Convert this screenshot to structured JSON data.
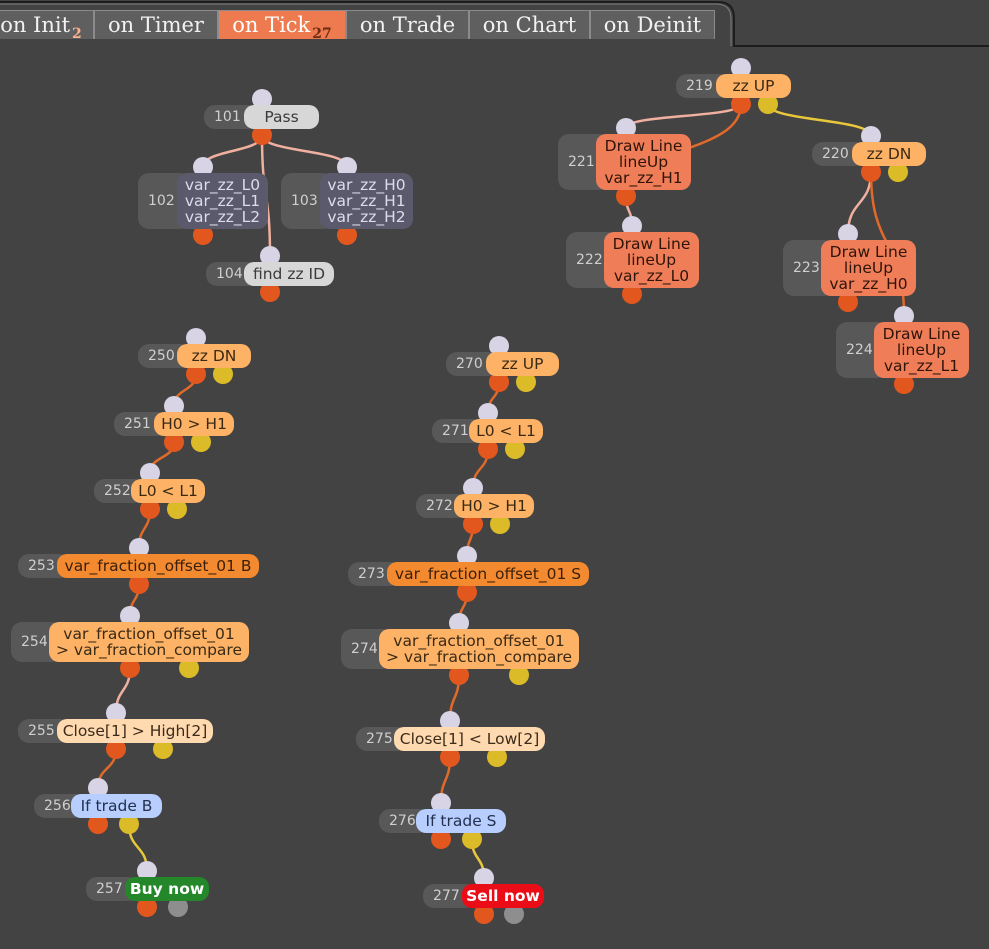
{
  "tabs": [
    {
      "label": "on Init",
      "badge": "2",
      "active": false
    },
    {
      "label": "on Timer",
      "badge": "",
      "active": false
    },
    {
      "label": "on Tick",
      "badge": "27",
      "active": true
    },
    {
      "label": "on Trade",
      "badge": "",
      "active": false
    },
    {
      "label": "on Chart",
      "badge": "",
      "active": false
    },
    {
      "label": "on Deinit",
      "badge": "",
      "active": false
    }
  ],
  "colors": {
    "background": "#434343",
    "active_tab": "#ee7b4f",
    "tab": "#5f5f5f",
    "wire_orange": "#e06a2a",
    "wire_pale": "#f0b0a0",
    "wire_yellow": "#e8c83a"
  },
  "nodes": {
    "n101": {
      "id": "101",
      "lines": [
        "Pass"
      ]
    },
    "n102": {
      "id": "102",
      "lines": [
        "var_zz_L0",
        "var_zz_L1",
        "var_zz_L2"
      ]
    },
    "n103": {
      "id": "103",
      "lines": [
        "var_zz_H0",
        "var_zz_H1",
        "var_zz_H2"
      ]
    },
    "n104": {
      "id": "104",
      "lines": [
        "find zz ID"
      ]
    },
    "n219": {
      "id": "219",
      "lines": [
        "zz UP"
      ]
    },
    "n220": {
      "id": "220",
      "lines": [
        "zz DN"
      ]
    },
    "n221": {
      "id": "221",
      "lines": [
        "Draw Line",
        "lineUp",
        "var_zz_H1"
      ]
    },
    "n222": {
      "id": "222",
      "lines": [
        "Draw Line",
        "lineUp",
        "var_zz_L0"
      ]
    },
    "n223": {
      "id": "223",
      "lines": [
        "Draw Line",
        "lineUp",
        "var_zz_H0"
      ]
    },
    "n224": {
      "id": "224",
      "lines": [
        "Draw Line",
        "lineUp",
        "var_zz_L1"
      ]
    },
    "n250": {
      "id": "250",
      "lines": [
        "zz DN"
      ]
    },
    "n251": {
      "id": "251",
      "lines": [
        "H0 > H1"
      ]
    },
    "n252": {
      "id": "252",
      "lines": [
        "L0 < L1"
      ]
    },
    "n253": {
      "id": "253",
      "lines": [
        "var_fraction_offset_01 B"
      ]
    },
    "n254": {
      "id": "254",
      "lines": [
        "var_fraction_offset_01",
        "> var_fraction_compare"
      ]
    },
    "n255": {
      "id": "255",
      "lines": [
        "Close[1] > High[2]"
      ]
    },
    "n256": {
      "id": "256",
      "lines": [
        "If trade B"
      ]
    },
    "n257": {
      "id": "257",
      "lines": [
        "Buy now"
      ]
    },
    "n270": {
      "id": "270",
      "lines": [
        "zz UP"
      ]
    },
    "n271": {
      "id": "271",
      "lines": [
        "L0 < L1"
      ]
    },
    "n272": {
      "id": "272",
      "lines": [
        "H0 > H1"
      ]
    },
    "n273": {
      "id": "273",
      "lines": [
        "var_fraction_offset_01 S"
      ]
    },
    "n274": {
      "id": "274",
      "lines": [
        "var_fraction_offset_01",
        "> var_fraction_compare"
      ]
    },
    "n275": {
      "id": "275",
      "lines": [
        "Close[1] < Low[2]"
      ]
    },
    "n276": {
      "id": "276",
      "lines": [
        "If trade S"
      ]
    },
    "n277": {
      "id": "277",
      "lines": [
        "Sell now"
      ]
    }
  }
}
